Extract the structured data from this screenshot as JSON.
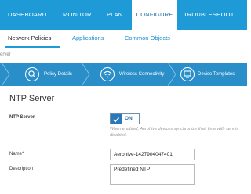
{
  "topnav": {
    "items": [
      "DASHBOARD",
      "MONITOR",
      "PLAN",
      "CONFIGURE",
      "TROUBLESHOOT"
    ],
    "active_color": "#ffffff",
    "bar_color": "#1e9bd7"
  },
  "subnav": {
    "items": [
      "Network Policies",
      "Applications",
      "Common Objects"
    ]
  },
  "breadcrumb": "erver",
  "wizard": {
    "steps": [
      "Policy Details",
      "Wireless Connectivity",
      "Device Templates"
    ],
    "icons": [
      "magnifier-icon",
      "wifi-icon",
      "device-icon"
    ]
  },
  "form": {
    "title": "NTP Server",
    "ntp_label": "NTP Server",
    "toggle_state": "ON",
    "note": "When enabled, Aerohive devices synchronize their time with serv is disabled.",
    "name_label": "Name*",
    "name_value": "Aerohive-1427904047401",
    "description_label": "Description",
    "description_value": "Predefined NTP"
  }
}
